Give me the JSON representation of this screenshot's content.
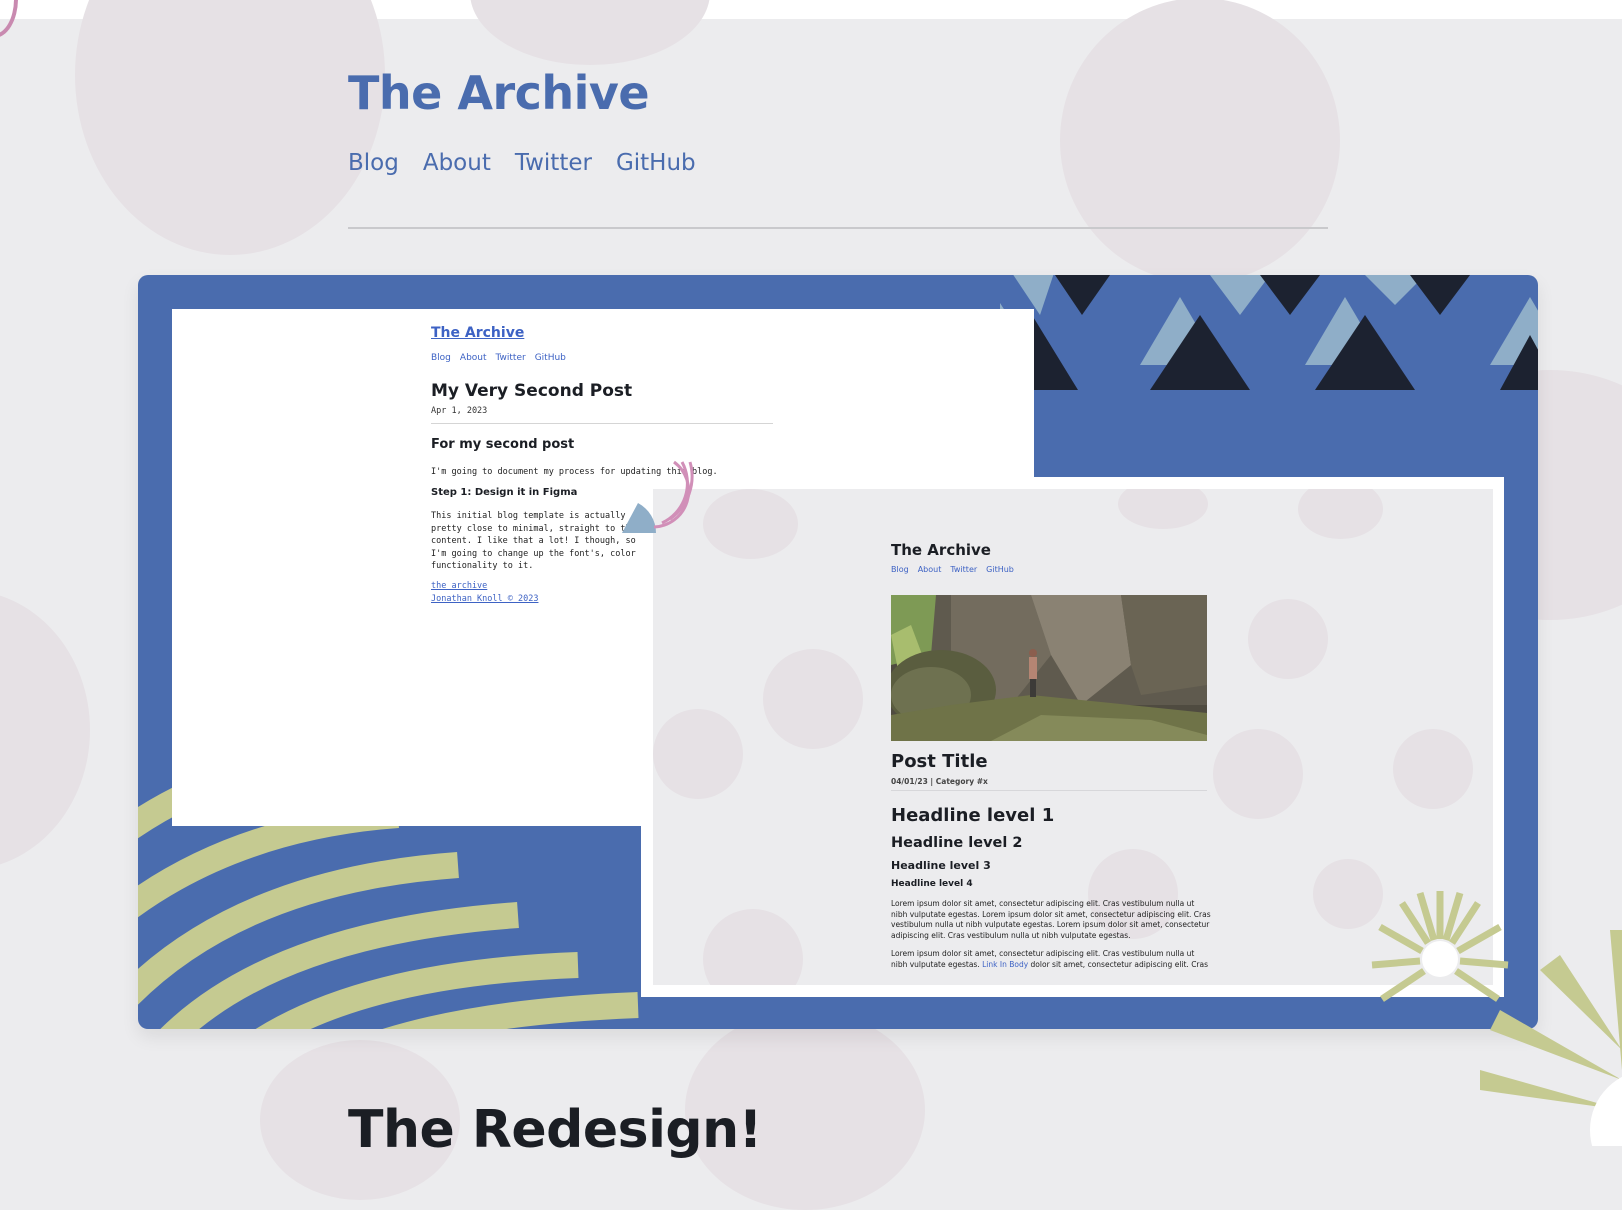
{
  "header": {
    "title": "The Archive",
    "nav": [
      "Blog",
      "About",
      "Twitter",
      "GitHub"
    ]
  },
  "colors": {
    "brand_blue": "#4A6CAE",
    "background": "#ECECEE",
    "accent_green": "#C5CA91",
    "accent_lightblue": "#8FAEC8",
    "accent_dark": "#1C2230",
    "accent_pink": "#D18FB8"
  },
  "showcase": {
    "old_design": {
      "site_title": "The Archive",
      "nav": [
        "Blog",
        "About",
        "Twitter",
        "GitHub"
      ],
      "post_title": "My Very Second Post",
      "date": "Apr 1, 2023",
      "heading": "For my second post",
      "intro": "I'm going to document my process for updating this blog.",
      "step_heading": "Step 1: Design it in Figma",
      "step_text": "This initial blog template is actually pretty close to minimal, straight to the content. I like that a lot! I though, so I'm going to change up the font's, color functionality to it.",
      "footer_link_1": "the archive",
      "footer_link_2": "Jonathan Knoll © 2023"
    },
    "new_design": {
      "site_title": "The Archive",
      "nav": [
        "Blog",
        "About",
        "Twitter",
        "GitHub"
      ],
      "post_title": "Post Title",
      "meta": "04/01/23 | Category #x",
      "headline_1": "Headline level 1",
      "headline_2": "Headline level 2",
      "headline_3": "Headline level 3",
      "headline_4": "Headline level 4",
      "paragraph_1": "Lorem ipsum dolor sit amet, consectetur adipiscing elit. Cras vestibulum nulla ut nibh vulputate egestas. Lorem ipsum dolor sit amet, consectetur adipiscing elit. Cras vestibulum nulla ut nibh vulputate egestas.  Lorem ipsum dolor sit amet, consectetur adipiscing elit. Cras vestibulum nulla ut nibh vulputate egestas.",
      "paragraph_2_start": "Lorem ipsum dolor sit amet, consectetur adipiscing elit. Cras vestibulum nulla ut nibh vulputate egestas.",
      "paragraph_2_link": "Link In Body",
      "paragraph_2_end": "dolor sit amet, consectetur adipiscing elit. Cras"
    }
  },
  "section_heading": "The Redesign!"
}
